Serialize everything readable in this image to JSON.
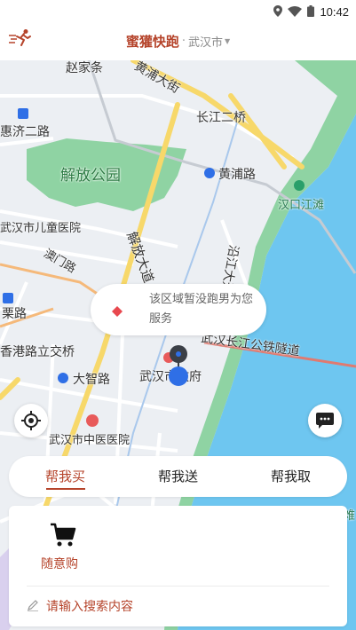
{
  "status_bar": {
    "time": "10:42"
  },
  "header": {
    "app_title": "蜜獾快跑",
    "separator": "·",
    "city": "武汉市"
  },
  "map": {
    "labels": {
      "zhaojiatiao": "赵家条",
      "huangpu_street": "黄浦大街",
      "changjiang_bridge": "长江二桥",
      "huiji_road": "惠济二路",
      "jiefang_park": "解放公园",
      "huangpu_road": "黄浦路",
      "hankou_riverside": "汉口江滩",
      "children_hospital": "武汉市儿童医院",
      "aomen_road": "澳门路",
      "jiefang_avenue": "解放大道",
      "yanjiang_avenue": "沿江大道",
      "lilu": "栗路",
      "hongkong_overpass": "香港路立交桥",
      "tunnel": "武汉长江公铁隧道",
      "dazhi_road": "大智路",
      "city_gov": "武汉市政府",
      "tcm_hospital": "武汉市中医医院",
      "edge_tail": "难"
    },
    "notice": "该区域暂没跑男为您服务"
  },
  "tabs": [
    {
      "label": "帮我买",
      "active": true
    },
    {
      "label": "帮我送",
      "active": false
    },
    {
      "label": "帮我取",
      "active": false
    }
  ],
  "panel": {
    "service_label": "随意购",
    "search_placeholder": "请输入搜索内容"
  },
  "colors": {
    "brand": "#b5432a",
    "water": "#6ec6f0",
    "park": "#8fd3a3",
    "road_major": "#f7d86a",
    "road": "#ffffff",
    "pin": "#2f6fe6"
  },
  "icons": [
    "runner-logo-icon",
    "location-icon",
    "wifi-icon",
    "battery-icon",
    "caret-down-icon",
    "diamond-marker-icon",
    "location-pin-icon",
    "locate-crosshair-icon",
    "chat-icon",
    "cart-icon",
    "pencil-icon"
  ]
}
